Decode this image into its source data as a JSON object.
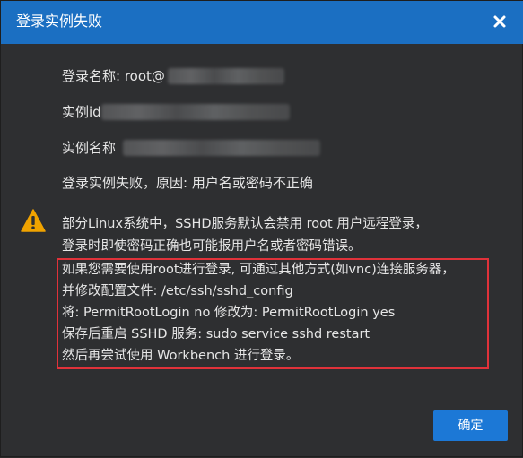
{
  "dialog": {
    "title": "登录实例失败",
    "close_icon": "close-icon"
  },
  "info": {
    "login_name_label": "登录名称: root@",
    "instance_id_label": "实例id",
    "instance_name_label": "实例名称",
    "reason": "登录实例失败，原因: 用户名或密码不正确"
  },
  "warning": {
    "icon": "warning-icon",
    "icon_color": "#f0a300",
    "line1": "部分Linux系统中，SSHD服务默认会禁用 root 用户远程登录，",
    "line2": "登录时即使密码正确也可能报用户名或者密码错误。"
  },
  "highlighted": {
    "border_color": "#e0323a",
    "lines": [
      "如果您需要使用root进行登录, 可通过其他方式(如vnc)连接服务器，",
      "并修改配置文件: /etc/ssh/sshd_config",
      "将: PermitRootLogin no 修改为: PermitRootLogin yes",
      "保存后重启 SSHD 服务: sudo service sshd restart",
      "然后再尝试使用 Workbench 进行登录。"
    ]
  },
  "buttons": {
    "ok_label": "确定"
  },
  "colors": {
    "titlebar": "#1b6fc2",
    "background": "#2e2f31",
    "primary_button": "#1c78d6",
    "text": "#e6e6e6"
  }
}
